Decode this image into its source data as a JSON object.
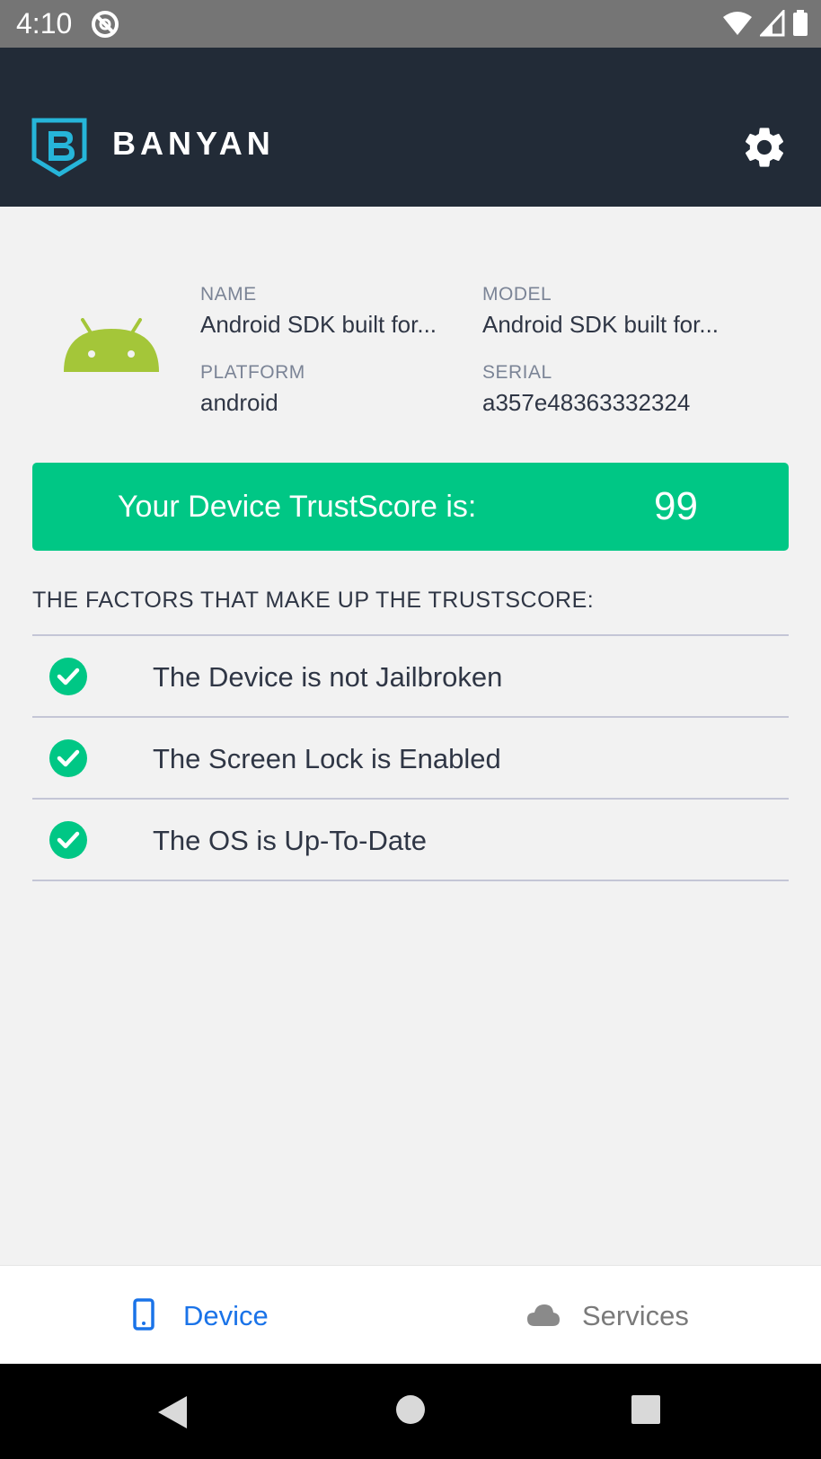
{
  "status_bar": {
    "time": "4:10"
  },
  "app_bar": {
    "brand": "BANYAN",
    "accent_color": "#26b5d9",
    "settings_icon": "gear-icon"
  },
  "device_info": {
    "icon": "android-icon",
    "name_label": "NAME",
    "name_value": "Android SDK built for...",
    "model_label": "MODEL",
    "model_value": "Android SDK built for...",
    "platform_label": "PLATFORM",
    "platform_value": "android",
    "serial_label": "SERIAL",
    "serial_value": "a357e48363332324"
  },
  "trust_score": {
    "label": "Your Device TrustScore is:",
    "value": "99",
    "color": "#00c785"
  },
  "factors": {
    "title": "THE FACTORS THAT MAKE UP THE TRUSTSCORE:",
    "items": [
      {
        "label": "The Device is not Jailbroken",
        "status": "check-circle-icon"
      },
      {
        "label": "The Screen Lock is Enabled",
        "status": "check-circle-icon"
      },
      {
        "label": "The OS is Up-To-Date",
        "status": "check-circle-icon"
      }
    ]
  },
  "bottom_nav": {
    "device_label": "Device",
    "services_label": "Services",
    "active": "Device",
    "active_color": "#1a73e8"
  }
}
